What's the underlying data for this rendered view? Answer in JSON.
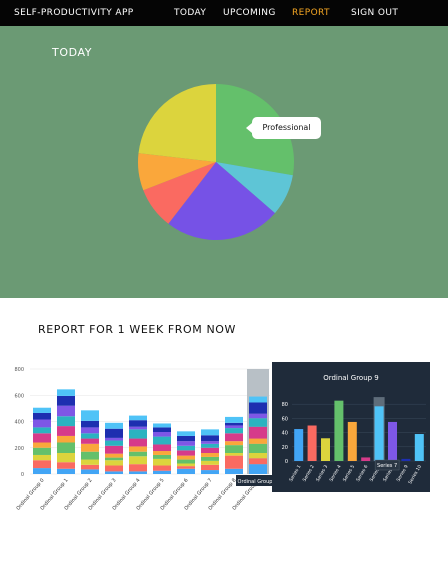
{
  "nav": {
    "app_title": "SELF-PRODUCTIVITY APP",
    "links": [
      "TODAY",
      "UPCOMING",
      "REPORT",
      "SIGN OUT"
    ],
    "active": "REPORT"
  },
  "today": {
    "title": "TODAY",
    "tooltip": "Professional"
  },
  "report": {
    "title": "REPORT FOR 1 WEEK FROM NOW"
  },
  "colors": {
    "navbar": "#050505",
    "active_link": "#f5a623",
    "today_bg": "#6b9a74",
    "popup_bg": "#1f2b3a"
  },
  "chart_data": [
    {
      "type": "pie",
      "slices": [
        {
          "label": "Professional",
          "value": 30.5,
          "color": "#64c06b"
        },
        {
          "label": "",
          "value": 9.5,
          "color": "#5ec5d6"
        },
        {
          "label": "",
          "value": 26.5,
          "color": "#7652e6"
        },
        {
          "label": "",
          "value": 9.5,
          "color": "#fa6a61"
        },
        {
          "label": "",
          "value": 8.5,
          "color": "#faa73b"
        },
        {
          "label": "",
          "value": 25.5,
          "color": "#dcd43d"
        }
      ]
    },
    {
      "type": "bar",
      "stacked": true,
      "categories": [
        "Ordinal Group 0",
        "Ordinal Group 1",
        "Ordinal Group 2",
        "Ordinal Group 3",
        "Ordinal Group 4",
        "Ordinal Group 5",
        "Ordinal Group 6",
        "Ordinal Group 7",
        "Ordinal Group 8",
        "Ordinal Group 9"
      ],
      "ylim": [
        0,
        800
      ],
      "yticks": [
        0,
        200,
        400,
        600,
        800
      ],
      "highlight": "Ordinal Group 9",
      "hover_label": "Ordinal Group",
      "segment_colors": [
        "#42a5f5",
        "#fa6a61",
        "#dcd43d",
        "#64c06b",
        "#faa73b",
        "#d63b8a",
        "#2bb3c0",
        "#7e57e6",
        "#1d2fb0",
        "#4fc3f7"
      ],
      "stacks": [
        [
          45,
          60,
          40,
          55,
          40,
          70,
          45,
          60,
          50,
          40
        ],
        [
          40,
          50,
          70,
          80,
          50,
          75,
          75,
          80,
          75,
          50
        ],
        [
          35,
          35,
          40,
          60,
          60,
          40,
          40,
          45,
          50,
          80
        ],
        [
          20,
          45,
          40,
          20,
          30,
          60,
          40,
          20,
          70,
          45
        ],
        [
          20,
          55,
          60,
          35,
          40,
          60,
          70,
          20,
          50,
          35
        ],
        [
          25,
          40,
          50,
          30,
          30,
          50,
          60,
          35,
          35,
          30
        ],
        [
          40,
          20,
          20,
          30,
          30,
          40,
          35,
          35,
          40,
          35
        ],
        [
          30,
          40,
          30,
          30,
          30,
          40,
          30,
          20,
          45,
          45
        ],
        [
          40,
          100,
          20,
          60,
          30,
          60,
          40,
          20,
          20,
          45
        ],
        [
          75,
          45,
          40,
          70,
          40,
          90,
          65,
          35,
          85,
          45
        ]
      ]
    },
    {
      "type": "bar",
      "title": "Ordinal Group 9",
      "categories": [
        "Series 1",
        "Series 2",
        "Series 3",
        "Series 4",
        "Series 5",
        "Series 6",
        "Series 7",
        "Series 8",
        "Series 9",
        "Series 10"
      ],
      "values": [
        45,
        50,
        32,
        85,
        55,
        5,
        77,
        55,
        3,
        38
      ],
      "colors": [
        "#42a5f5",
        "#fa6a61",
        "#dcd43d",
        "#64c06b",
        "#faa73b",
        "#d63b8a",
        "#4fc3f7",
        "#7e57e6",
        "#1d2fb0",
        "#4fc3f7"
      ],
      "highlight_index": 6,
      "ylim": [
        0,
        100
      ],
      "yticks": [
        0,
        20,
        40,
        60,
        80
      ],
      "tooltip": "Series 7"
    }
  ]
}
